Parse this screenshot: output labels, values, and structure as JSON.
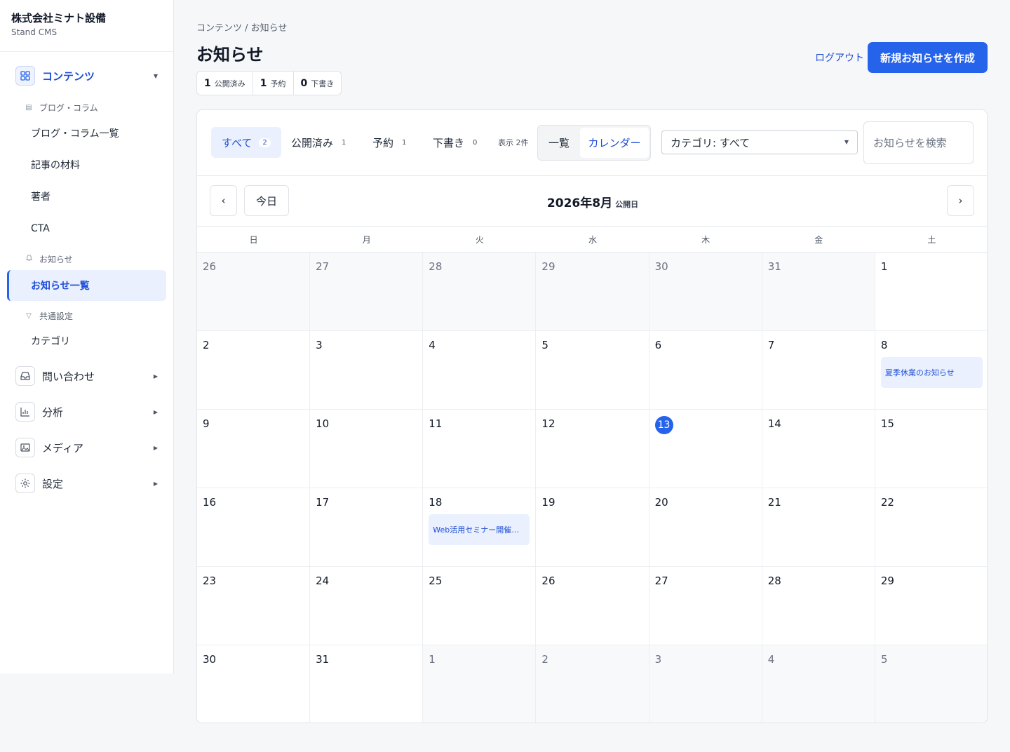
{
  "brand": {
    "name": "株式会社ミナト設備",
    "sub": "Stand CMS"
  },
  "sidebar": {
    "groups": [
      {
        "label": "コンテンツ",
        "icon": "grid-icon"
      },
      {
        "label": "問い合わせ",
        "icon": "inbox-icon"
      },
      {
        "label": "分析",
        "icon": "chart-icon"
      },
      {
        "label": "メディア",
        "icon": "image-icon"
      },
      {
        "label": "設定",
        "icon": "gear-icon"
      }
    ],
    "subheads": [
      "ブログ・コラム",
      "お知らせ",
      "共通設定"
    ],
    "items": [
      "ブログ・コラム一覧",
      "記事の材料",
      "著者",
      "CTA",
      "お知らせ一覧",
      "カテゴリ"
    ]
  },
  "header": {
    "breadcrumb": "コンテンツ / お知らせ",
    "title": "お知らせ",
    "stats": [
      {
        "count": "1",
        "label": "公開済み"
      },
      {
        "count": "1",
        "label": "予約"
      },
      {
        "count": "0",
        "label": "下書き"
      }
    ],
    "logout": "ログアウト",
    "create": "新規お知らせを作成"
  },
  "toolbar": {
    "tabs": [
      {
        "label": "すべて",
        "count": "2"
      },
      {
        "label": "公開済み",
        "count": "1"
      },
      {
        "label": "予約",
        "count": "1"
      },
      {
        "label": "下書き",
        "count": "0"
      }
    ],
    "showcount": "表示 2件",
    "view_list": "一覧",
    "view_calendar": "カレンダー",
    "category": "カテゴリ: すべて",
    "search_placeholder": "お知らせを検索"
  },
  "calendar": {
    "prev": "‹",
    "today": "今日",
    "next": "›",
    "month": "2026年8月",
    "month_sub": "公開日",
    "weekdays": [
      "日",
      "月",
      "火",
      "水",
      "木",
      "金",
      "土"
    ],
    "days": [
      {
        "d": "26",
        "m": true
      },
      {
        "d": "27",
        "m": true
      },
      {
        "d": "28",
        "m": true
      },
      {
        "d": "29",
        "m": true
      },
      {
        "d": "30",
        "m": true
      },
      {
        "d": "31",
        "m": true
      },
      {
        "d": "1"
      },
      {
        "d": "2"
      },
      {
        "d": "3"
      },
      {
        "d": "4"
      },
      {
        "d": "5"
      },
      {
        "d": "6"
      },
      {
        "d": "7"
      },
      {
        "d": "8",
        "event": "夏季休業のお知らせ"
      },
      {
        "d": "9"
      },
      {
        "d": "10"
      },
      {
        "d": "11"
      },
      {
        "d": "12"
      },
      {
        "d": "13",
        "today": true
      },
      {
        "d": "14"
      },
      {
        "d": "15"
      },
      {
        "d": "16"
      },
      {
        "d": "17"
      },
      {
        "d": "18",
        "event": "Web活用セミナー開催…"
      },
      {
        "d": "19"
      },
      {
        "d": "20"
      },
      {
        "d": "21"
      },
      {
        "d": "22"
      },
      {
        "d": "23"
      },
      {
        "d": "24"
      },
      {
        "d": "25"
      },
      {
        "d": "26"
      },
      {
        "d": "27"
      },
      {
        "d": "28"
      },
      {
        "d": "29"
      },
      {
        "d": "30"
      },
      {
        "d": "31"
      },
      {
        "d": "1",
        "m": true
      },
      {
        "d": "2",
        "m": true
      },
      {
        "d": "3",
        "m": true
      },
      {
        "d": "4",
        "m": true
      },
      {
        "d": "5",
        "m": true
      }
    ]
  },
  "colors": {
    "accent": "#2563eb",
    "accent_bg": "#eaf0fd"
  }
}
